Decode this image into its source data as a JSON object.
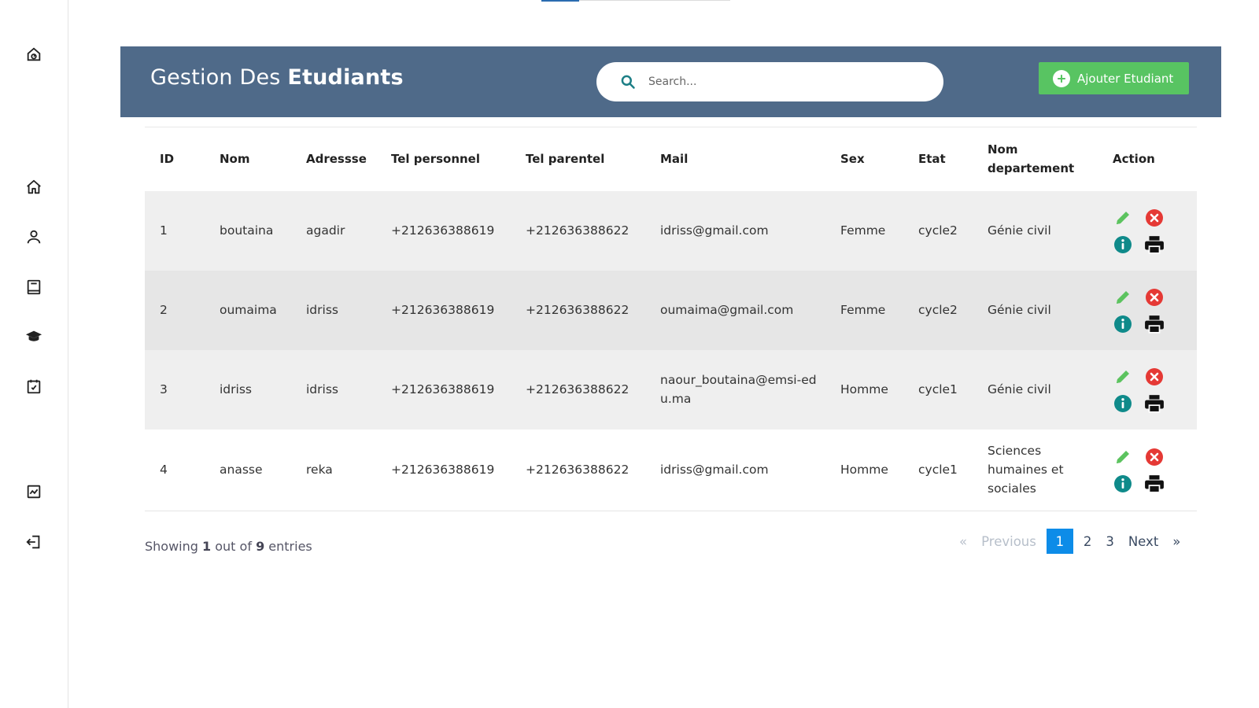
{
  "header": {
    "title_light": "Gestion Des",
    "title_bold": "Etudiants",
    "add_button_label": "Ajouter Etudiant"
  },
  "search": {
    "placeholder": "Search..."
  },
  "sidebar": {
    "items": [
      {
        "icon": "dashboard-icon"
      },
      {
        "icon": "home-icon"
      },
      {
        "icon": "user-icon"
      },
      {
        "icon": "book-icon"
      },
      {
        "icon": "graduation-cap-icon"
      },
      {
        "icon": "calendar-check-icon"
      },
      {
        "icon": "chart-icon"
      },
      {
        "icon": "logout-icon"
      }
    ]
  },
  "table": {
    "columns": {
      "id": "ID",
      "nom": "Nom",
      "adresse": "Adressse",
      "tel_personnel": "Tel personnel",
      "tel_parentel": "Tel parentel",
      "mail": "Mail",
      "sex": "Sex",
      "etat": "Etat",
      "nom_departement_1": "Nom",
      "nom_departement_2": "departement",
      "action": "Action"
    },
    "rows": [
      {
        "id": "1",
        "nom": "boutaina",
        "adresse": "agadir",
        "tel_personnel": "+212636388619",
        "tel_parentel": "+212636388622",
        "mail": "idriss@gmail.com",
        "sex": "Femme",
        "etat": "cycle2",
        "departement": "Génie civil"
      },
      {
        "id": "2",
        "nom": "oumaima",
        "adresse": "idriss",
        "tel_personnel": "+212636388619",
        "tel_parentel": "+212636388622",
        "mail": "oumaima@gmail.com",
        "sex": "Femme",
        "etat": "cycle2",
        "departement": "Génie civil"
      },
      {
        "id": "3",
        "nom": "idriss",
        "adresse": "idriss",
        "tel_personnel": "+212636388619",
        "tel_parentel": "+212636388622",
        "mail": "naour_boutaina@emsi-edu.ma",
        "sex": "Homme",
        "etat": "cycle1",
        "departement": "Génie civil"
      },
      {
        "id": "4",
        "nom": "anasse",
        "adresse": "reka",
        "tel_personnel": "+212636388619",
        "tel_parentel": "+212636388622",
        "mail": "idriss@gmail.com",
        "sex": "Homme",
        "etat": "cycle1",
        "departement": "Sciences humaines et sociales"
      }
    ]
  },
  "footer": {
    "showing_prefix": "Showing",
    "current": "1",
    "out_of": "out of",
    "total": "9",
    "entries": "entries"
  },
  "pagination": {
    "prev_arrow": "«",
    "previous": "Previous",
    "pages": [
      "1",
      "2",
      "3"
    ],
    "active_page": "1",
    "next": "Next",
    "next_arrow": "»"
  },
  "colors": {
    "header_bg": "#4f6a89",
    "add_button": "#58c462",
    "edit_icon": "#5cc35f",
    "delete_icon": "#e53935",
    "info_icon": "#0f8a8a",
    "active_page": "#0d8ce8"
  }
}
